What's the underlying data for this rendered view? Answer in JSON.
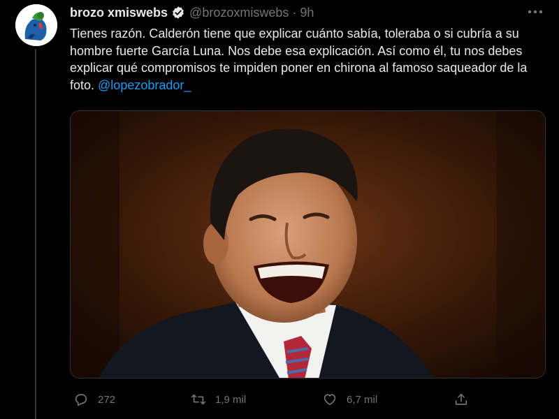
{
  "author": {
    "display_name": "brozo xmiswebs",
    "handle": "@brozoxmiswebs",
    "separator": "·",
    "time": "9h",
    "verified": true
  },
  "tweet": {
    "text": "Tienes razón. Calderón tiene que explicar cuánto sabía, toleraba o si cubría a su hombre fuerte García Luna. Nos debe esa explicación. Así como él, tu nos debes explicar qué compromisos te impiden poner en chirona al famoso saqueador de la foto. ",
    "mention": "@lopezobrador_"
  },
  "actions": {
    "replies": "272",
    "retweets": "1,9 mil",
    "likes": "6,7 mil"
  },
  "icons": {
    "more": "more-dots-icon",
    "verified": "verified-badge-icon",
    "reply": "reply-icon",
    "retweet": "retweet-icon",
    "like": "heart-icon",
    "share": "share-icon"
  },
  "colors": {
    "background": "#000000",
    "text": "#e7e9ea",
    "secondary": "#71767b",
    "link": "#1d9bf0"
  }
}
